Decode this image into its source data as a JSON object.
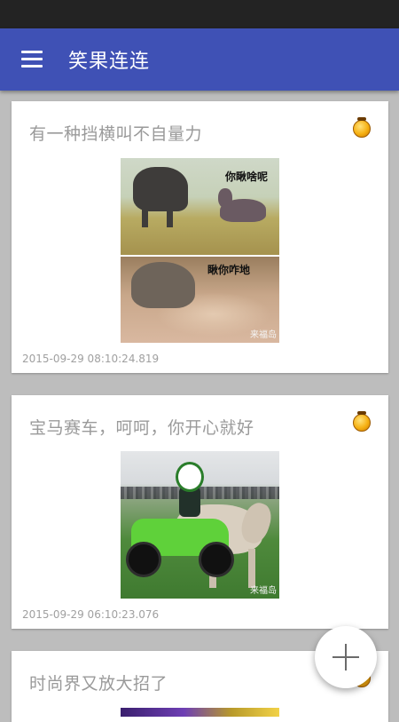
{
  "app": {
    "title": "笑果连连"
  },
  "posts": [
    {
      "title": "有一种挡横叫不自量力",
      "time": "2015-09-29 08:10:24.819",
      "image_captions": [
        "你瞅啥呢",
        "瞅你咋地"
      ],
      "watermark": "来福岛"
    },
    {
      "title": "宝马赛车，呵呵，你开心就好",
      "time": "2015-09-29 06:10:23.076",
      "watermark": "来福岛"
    },
    {
      "title": "时尚界又放大招了"
    }
  ],
  "icons": {
    "menu": "hamburger-menu-icon",
    "medal": "gold-medal-icon",
    "add": "plus-icon"
  }
}
